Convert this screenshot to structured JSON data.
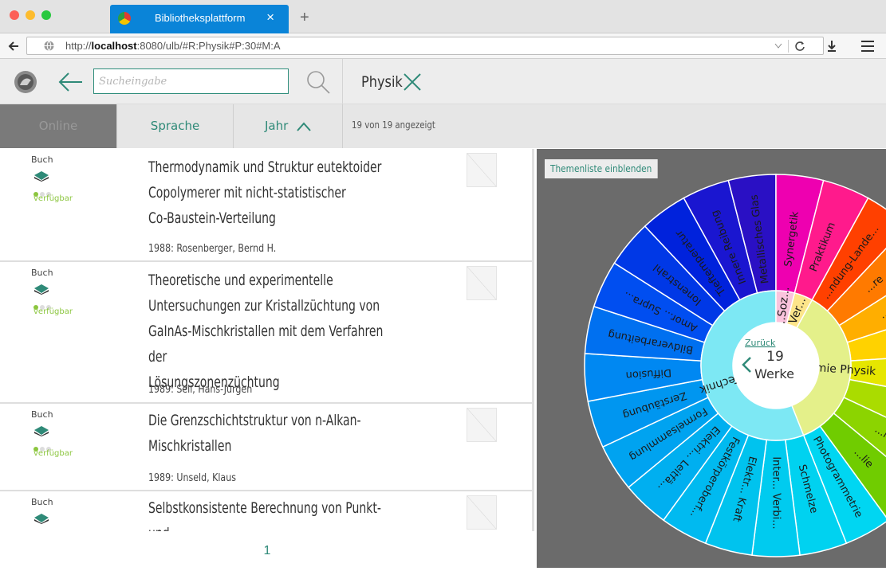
{
  "browser": {
    "tab_title": "Bibliotheksplattform",
    "close_glyph": "×",
    "new_tab_glyph": "+",
    "url_prefix": "http://",
    "url_host": "localhost",
    "url_rest": ":8080/ulb/#R:Physik#P:30#M:A"
  },
  "header": {
    "search_placeholder": "Sucheingabe",
    "active_filter": "Physik"
  },
  "filters": {
    "online": "Online",
    "sprache": "Sprache",
    "jahr": "Jahr",
    "count_text": "19 von 19 angezeigt"
  },
  "results": [
    {
      "type": "Buch",
      "status": "verfügbar",
      "title": "Thermodynamik und Struktur eutektoider\nCopolymerer mit nicht-statistischer\nCo-Baustein-Verteilung",
      "meta": "1988: Rosenberger, Bernd H."
    },
    {
      "type": "Buch",
      "status": "verfügbar",
      "title": "Theoretische und experimentelle\nUntersuchungen zur Kristallzüchtung von\nGaInAs-Mischkristallen mit dem Verfahren der\nLösungszonenzüchtung",
      "meta": "1989: Sell, Hans-Jürgen"
    },
    {
      "type": "Buch",
      "status": "verfügbar",
      "title": "Die Grenzschichtstruktur von n-Alkan-\nMischkristallen",
      "meta": "1989: Unseld, Klaus"
    },
    {
      "type": "Buch",
      "status": "",
      "title": "Selbstkonsistente Berechnung von Punkt- und",
      "meta": ""
    }
  ],
  "pager": {
    "page": "1"
  },
  "panel": {
    "show_list": "Themenliste einblenden",
    "center_back": "Zurück",
    "center_count": "19",
    "center_label": "Werke",
    "inner_ring": [
      "Technik",
      "Chemie Physik",
      "Ver...",
      "...Soz..."
    ],
    "outer_ring": [
      "Photogrammetrie",
      "Schmelze",
      "Inter... Verbi...",
      "Elektr... Kraft",
      "Festkörperoberf...",
      "Elektri... Leitfä...",
      "Formelsammlung",
      "Zerstäubung",
      "Diffusion",
      "Bildverarbeitung",
      "Amor... Supra...",
      "Ionenstrahl",
      "Tieftemperatur",
      "Innere Reibung",
      "Metallisches Glas",
      "Synergetik",
      "Praktikum",
      "...ndung-Lande...",
      "...re",
      "...na",
      "...st",
      "...pa",
      "...n",
      "...ie",
      "...lie"
    ]
  },
  "colors": {
    "accent": "#2f8a78",
    "available": "#8cc63f",
    "tab_blue": "#0a84d8"
  }
}
